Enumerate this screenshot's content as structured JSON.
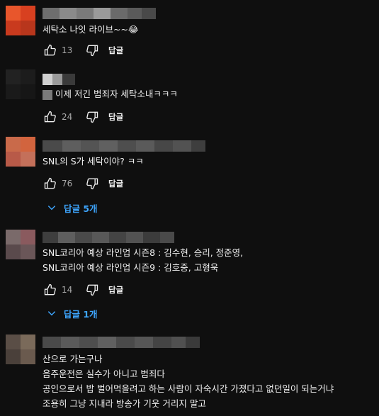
{
  "comments": [
    {
      "text_lines": [
        "세탁소 나잇 라이브~~😂"
      ],
      "likes": "13",
      "reply_label": "답글"
    },
    {
      "text_lines": [
        "이제 저긴 범죄자 세탁소내ㅋㅋㅋ"
      ],
      "likes": "24",
      "reply_label": "답글"
    },
    {
      "text_lines": [
        "SNL의 S가 세탁이야? ㅋㅋ"
      ],
      "likes": "76",
      "reply_label": "답글",
      "replies_label": "답글 5개"
    },
    {
      "text_lines": [
        "SNL코리아 예상 라인업 시즌8 : 김수현, 승리, 정준영,",
        "SNL코리아 예상 라인업 시즌9 : 김호중, 고형욱"
      ],
      "likes": "14",
      "reply_label": "답글",
      "replies_label": "답글 1개"
    },
    {
      "text_lines": [
        "산으로  가는구나",
        "음주운전은  실수가 아니고 범죄다",
        "공인으로서 밥 벌어먹을려고 하는 사람이  자숙시간 가졌다고  없던일이 되는거냐",
        "조용히  그냥 지내라  방송가  기웃 거리지 말고"
      ]
    }
  ],
  "colors": {
    "background": "#0f0f0f",
    "text": "#f1f1f1",
    "secondary": "#aaaaaa",
    "link": "#3ea6ff"
  },
  "icons": [
    "thumb-up-icon",
    "thumb-down-icon",
    "chevron-down-icon"
  ]
}
